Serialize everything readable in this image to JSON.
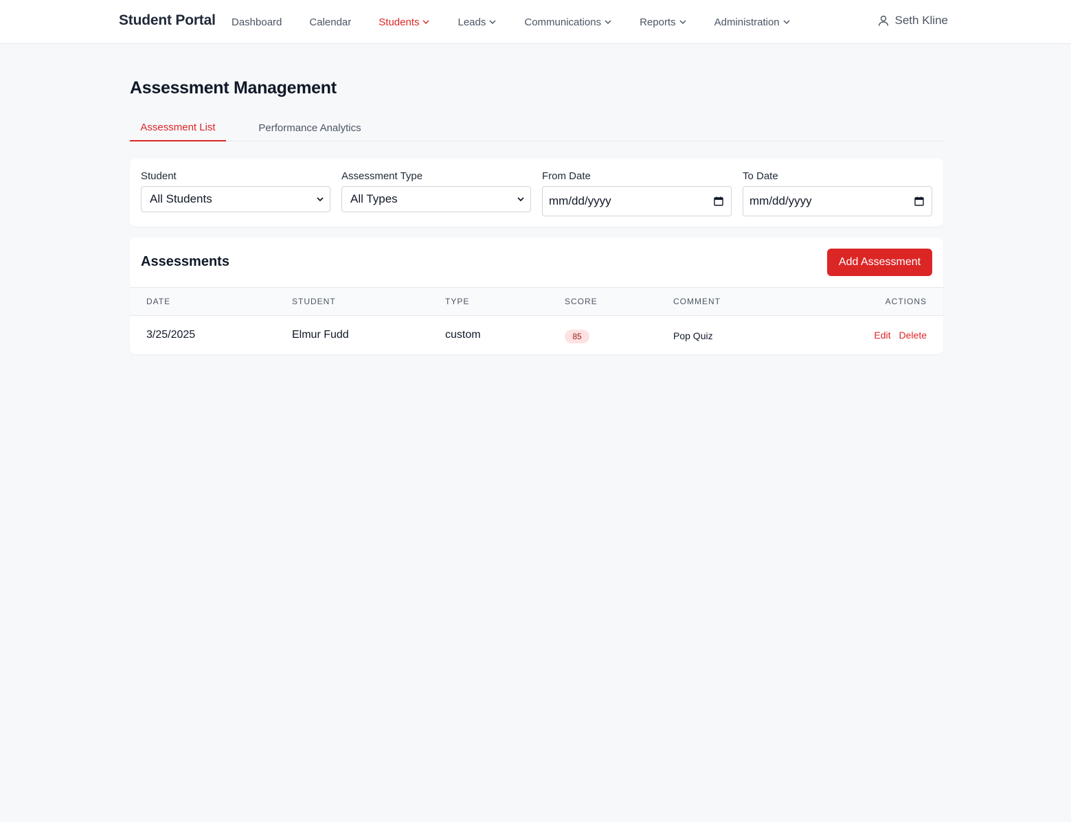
{
  "app": {
    "brand": "Student Portal",
    "user_name": "Seth Kline"
  },
  "nav": {
    "items": [
      {
        "label": "Dashboard",
        "dropdown": false,
        "active": false
      },
      {
        "label": "Calendar",
        "dropdown": false,
        "active": false
      },
      {
        "label": "Students",
        "dropdown": true,
        "active": true
      },
      {
        "label": "Leads",
        "dropdown": true,
        "active": false
      },
      {
        "label": "Communications",
        "dropdown": true,
        "active": false
      },
      {
        "label": "Reports",
        "dropdown": true,
        "active": false
      },
      {
        "label": "Administration",
        "dropdown": true,
        "active": false
      }
    ]
  },
  "page": {
    "title": "Assessment Management",
    "tabs": [
      {
        "label": "Assessment List",
        "active": true
      },
      {
        "label": "Performance Analytics",
        "active": false
      }
    ]
  },
  "filters": {
    "student": {
      "label": "Student",
      "value": "All Students"
    },
    "type": {
      "label": "Assessment Type",
      "value": "All Types"
    },
    "from": {
      "label": "From Date",
      "placeholder": "mm/dd/yyyy"
    },
    "to": {
      "label": "To Date",
      "placeholder": "mm/dd/yyyy"
    }
  },
  "assessments": {
    "title": "Assessments",
    "add_label": "Add Assessment",
    "columns": [
      "Date",
      "Student",
      "Type",
      "Score",
      "Comment",
      "Actions"
    ],
    "rows": [
      {
        "date": "3/25/2025",
        "student": "Elmur Fudd",
        "type": "custom",
        "score": "85",
        "comment": "Pop Quiz",
        "edit": "Edit",
        "delete": "Delete"
      }
    ]
  },
  "colors": {
    "accent": "#dc2626",
    "background": "#f7f8fa",
    "badge_bg": "#fee2e2"
  }
}
